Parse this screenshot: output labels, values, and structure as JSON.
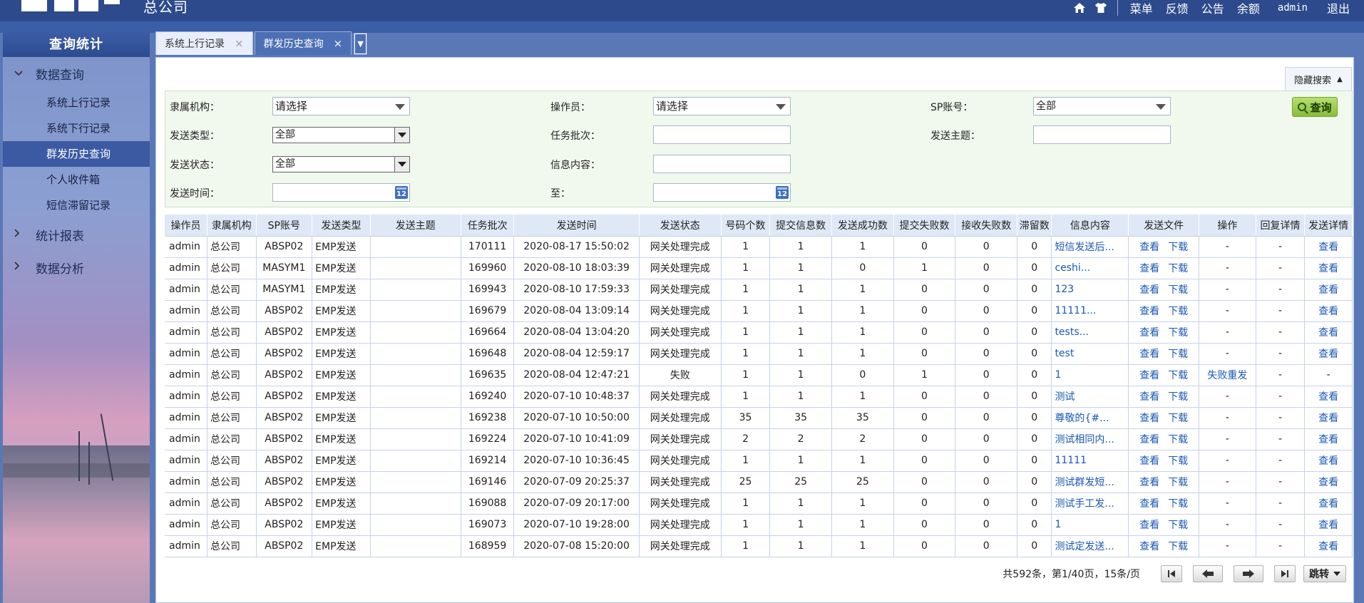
{
  "header": {
    "company": "总公司",
    "nav": [
      "菜单",
      "反馈",
      "公告",
      "余额",
      "admin",
      "退出"
    ]
  },
  "sidebar": {
    "title": "查询统计",
    "groups": [
      {
        "label": "数据查询",
        "expanded": true,
        "items": [
          "系统上行记录",
          "系统下行记录",
          "群发历史查询",
          "个人收件箱",
          "短信滞留记录"
        ]
      },
      {
        "label": "统计报表",
        "expanded": false
      },
      {
        "label": "数据分析",
        "expanded": false
      }
    ],
    "active_item": "群发历史查询"
  },
  "tabs": [
    {
      "label": "系统上行记录",
      "active": false
    },
    {
      "label": "群发历史查询",
      "active": true
    }
  ],
  "search": {
    "toggle_label": "隐藏搜索",
    "fields": {
      "org_label": "隶属机构：",
      "org_value": "请选择",
      "operator_label": "操作员：",
      "operator_value": "请选择",
      "sp_label": "SP账号：",
      "sp_value": "全部",
      "send_type_label": "发送类型：",
      "send_type_value": "全部",
      "task_batch_label": "任务批次：",
      "subject_label": "发送主题：",
      "status_label": "发送状态：",
      "status_value": "全部",
      "content_label": "信息内容：",
      "time_label": "发送时间：",
      "to_label": "至："
    },
    "calendar_icon_text": "12",
    "query_button": "查询"
  },
  "table": {
    "columns": [
      "操作员",
      "隶属机构",
      "SP账号",
      "发送类型",
      "发送主题",
      "任务批次",
      "发送时间",
      "发送状态",
      "号码个数",
      "提交信息数",
      "发送成功数",
      "提交失败数",
      "接收失败数",
      "滞留数",
      "信息内容",
      "发送文件",
      "操作",
      "回复详情",
      "发送详情"
    ],
    "file_links": [
      "查看",
      "下载"
    ],
    "rows": [
      [
        "admin",
        "总公司",
        "ABSP02",
        "EMP发送",
        "",
        "170111",
        "2020-08-17 15:50:02",
        "网关处理完成",
        "1",
        "1",
        "1",
        "0",
        "0",
        "0",
        "短信发送后...",
        "-",
        "-",
        "查看"
      ],
      [
        "admin",
        "总公司",
        "MASYM1",
        "EMP发送",
        "",
        "169960",
        "2020-08-10 18:03:39",
        "网关处理完成",
        "1",
        "1",
        "0",
        "1",
        "0",
        "0",
        "ceshi...",
        "-",
        "-",
        "查看"
      ],
      [
        "admin",
        "总公司",
        "MASYM1",
        "EMP发送",
        "",
        "169943",
        "2020-08-10 17:59:33",
        "网关处理完成",
        "1",
        "1",
        "1",
        "0",
        "0",
        "0",
        "123",
        "-",
        "-",
        "查看"
      ],
      [
        "admin",
        "总公司",
        "ABSP02",
        "EMP发送",
        "",
        "169679",
        "2020-08-04 13:09:14",
        "网关处理完成",
        "1",
        "1",
        "1",
        "0",
        "0",
        "0",
        "11111...",
        "-",
        "-",
        "查看"
      ],
      [
        "admin",
        "总公司",
        "ABSP02",
        "EMP发送",
        "",
        "169664",
        "2020-08-04 13:04:20",
        "网关处理完成",
        "1",
        "1",
        "1",
        "0",
        "0",
        "0",
        "tests...",
        "-",
        "-",
        "查看"
      ],
      [
        "admin",
        "总公司",
        "ABSP02",
        "EMP发送",
        "",
        "169648",
        "2020-08-04 12:59:17",
        "网关处理完成",
        "1",
        "1",
        "1",
        "0",
        "0",
        "0",
        "test",
        "-",
        "-",
        "查看"
      ],
      [
        "admin",
        "总公司",
        "ABSP02",
        "EMP发送",
        "",
        "169635",
        "2020-08-04 12:47:21",
        "失败",
        "1",
        "1",
        "0",
        "1",
        "0",
        "0",
        "1",
        "失败重发",
        "-",
        "-"
      ],
      [
        "admin",
        "总公司",
        "ABSP02",
        "EMP发送",
        "",
        "169240",
        "2020-07-10 10:48:37",
        "网关处理完成",
        "1",
        "1",
        "1",
        "0",
        "0",
        "0",
        "测试",
        "-",
        "-",
        "查看"
      ],
      [
        "admin",
        "总公司",
        "ABSP02",
        "EMP发送",
        "",
        "169238",
        "2020-07-10 10:50:00",
        "网关处理完成",
        "35",
        "35",
        "35",
        "0",
        "0",
        "0",
        "尊敬的{#...",
        "-",
        "-",
        "查看"
      ],
      [
        "admin",
        "总公司",
        "ABSP02",
        "EMP发送",
        "",
        "169224",
        "2020-07-10 10:41:09",
        "网关处理完成",
        "2",
        "2",
        "2",
        "0",
        "0",
        "0",
        "测试相同内...",
        "-",
        "-",
        "查看"
      ],
      [
        "admin",
        "总公司",
        "ABSP02",
        "EMP发送",
        "",
        "169214",
        "2020-07-10 10:36:45",
        "网关处理完成",
        "1",
        "1",
        "1",
        "0",
        "0",
        "0",
        "11111",
        "-",
        "-",
        "查看"
      ],
      [
        "admin",
        "总公司",
        "ABSP02",
        "EMP发送",
        "",
        "169146",
        "2020-07-09 20:25:37",
        "网关处理完成",
        "25",
        "25",
        "25",
        "0",
        "0",
        "0",
        "测试群发短...",
        "-",
        "-",
        "查看"
      ],
      [
        "admin",
        "总公司",
        "ABSP02",
        "EMP发送",
        "",
        "169088",
        "2020-07-09 20:17:00",
        "网关处理完成",
        "1",
        "1",
        "1",
        "0",
        "0",
        "0",
        "测试手工发...",
        "-",
        "-",
        "查看"
      ],
      [
        "admin",
        "总公司",
        "ABSP02",
        "EMP发送",
        "",
        "169073",
        "2020-07-10 19:28:00",
        "网关处理完成",
        "1",
        "1",
        "1",
        "0",
        "0",
        "0",
        "1",
        "-",
        "-",
        "查看"
      ],
      [
        "admin",
        "总公司",
        "ABSP02",
        "EMP发送",
        "",
        "168959",
        "2020-07-08 15:20:00",
        "网关处理完成",
        "1",
        "1",
        "1",
        "0",
        "0",
        "0",
        "测试定发送...",
        "-",
        "-",
        "查看"
      ]
    ]
  },
  "pager": {
    "info": "共592条，第1/40页，15条/页",
    "jump_label": "跳转"
  },
  "colors": {
    "primary": "#2d4a8c",
    "accent": "#4c6fb5",
    "link": "#1958b7",
    "search_bg": "#f1f8ee"
  }
}
